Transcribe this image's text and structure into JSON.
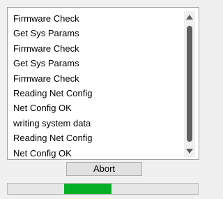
{
  "log": {
    "lines": [
      "Firmware Check",
      "Get Sys Params",
      "Firmware Check",
      "Get Sys Params",
      "Firmware Check",
      "Reading Net Config",
      "Net Config OK",
      "writing system data",
      "Reading Net Config",
      "Net Config OK"
    ]
  },
  "actions": {
    "abort_label": "Abort"
  },
  "progress": {
    "style": "marquee",
    "segment_start": 0.295,
    "segment_end": 0.545,
    "color": "#06b025"
  }
}
